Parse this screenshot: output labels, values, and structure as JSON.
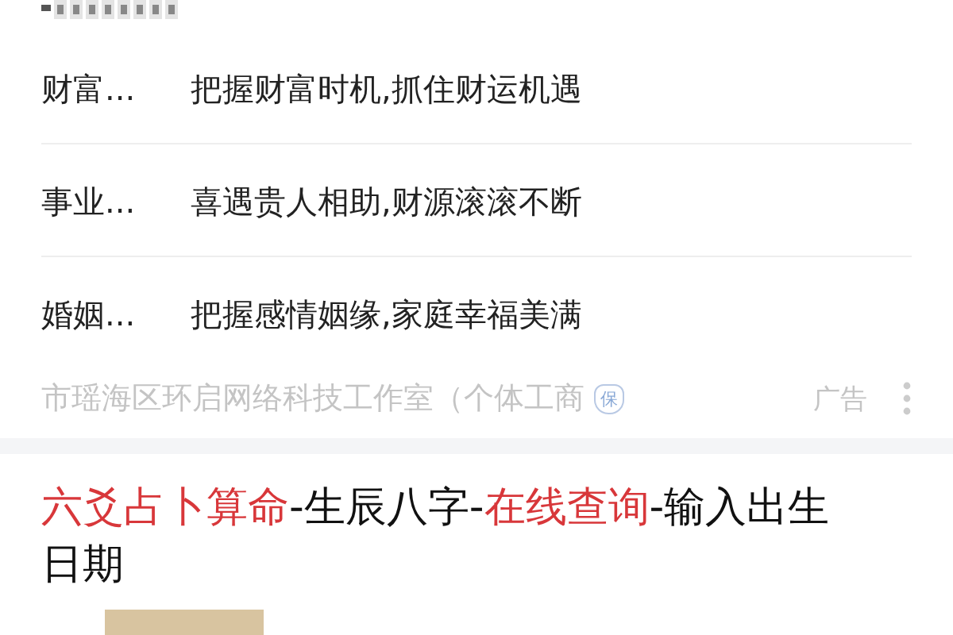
{
  "ad": {
    "rows": [
      {
        "label": "财富...",
        "text": "把握财富时机,抓住财运机遇"
      },
      {
        "label": "事业...",
        "text": "喜遇贵人相助,财源滚滚不断"
      },
      {
        "label": "婚姻...",
        "text": "把握感情姻缘,家庭幸福美满"
      }
    ],
    "advertiser": "市瑶海区环启网络科技工作室（个体工商",
    "badge": "保",
    "ad_label": "广告"
  },
  "result": {
    "title": [
      {
        "text": "六爻占卜算命",
        "highlight": true
      },
      {
        "text": "-生辰八字-",
        "highlight": false
      },
      {
        "text": "在线查询",
        "highlight": true
      },
      {
        "text": "-输入出生日期",
        "highlight": false
      }
    ]
  }
}
